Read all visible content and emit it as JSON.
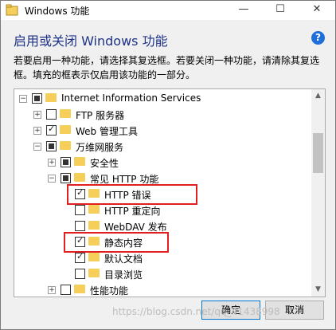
{
  "window": {
    "title": "Windows 功能"
  },
  "titlebar_buttons": {
    "minimize": "—",
    "maximize": "☐",
    "close": "✕"
  },
  "header": {
    "title": "启用或关闭 Windows 功能",
    "help": "?"
  },
  "description": {
    "line1": "若要启用一种功能，请选择其复选框。若要关闭一种功能，请清除其复选",
    "line2": "框。填充的框表示仅启用该功能的一部分。"
  },
  "tree": {
    "items": [
      {
        "label": "Internet Information Services",
        "state": "partial",
        "expander": "minus"
      },
      {
        "label": "FTP 服务器",
        "state": "unchecked",
        "expander": "plus"
      },
      {
        "label": "Web 管理工具",
        "state": "checked",
        "expander": "plus"
      },
      {
        "label": "万维网服务",
        "state": "partial",
        "expander": "minus"
      },
      {
        "label": "安全性",
        "state": "partial",
        "expander": "plus"
      },
      {
        "label": "常见 HTTP 功能",
        "state": "partial",
        "expander": "minus"
      },
      {
        "label": "HTTP 错误",
        "state": "checked",
        "expander": "none"
      },
      {
        "label": "HTTP 重定向",
        "state": "unchecked",
        "expander": "none"
      },
      {
        "label": "WebDAV 发布",
        "state": "unchecked",
        "expander": "none"
      },
      {
        "label": "静态内容",
        "state": "checked",
        "expander": "none"
      },
      {
        "label": "默认文档",
        "state": "checked",
        "expander": "none"
      },
      {
        "label": "目录浏览",
        "state": "unchecked",
        "expander": "none"
      },
      {
        "label": "性能功能",
        "state": "unchecked",
        "expander": "plus"
      }
    ]
  },
  "buttons": {
    "ok": "确定",
    "cancel": "取消"
  },
  "watermark": "https://blog.csdn.net/qq_41438998"
}
